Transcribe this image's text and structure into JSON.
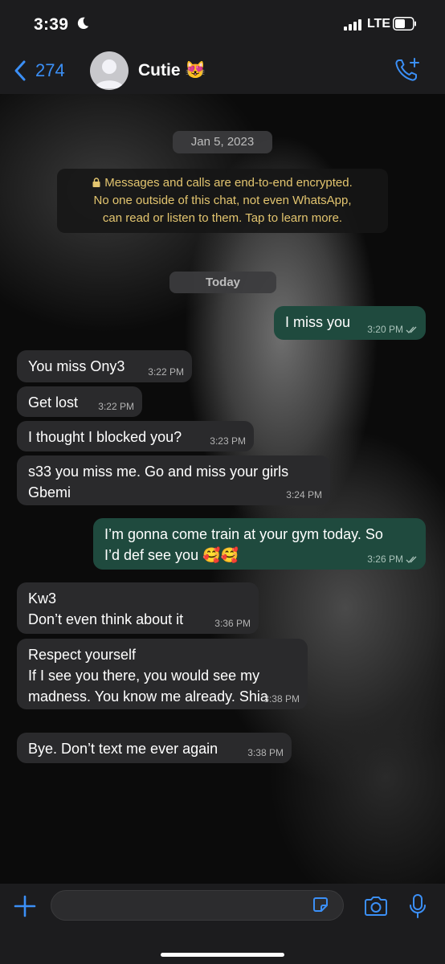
{
  "status_bar": {
    "time": "3:39",
    "network": "LTE"
  },
  "header": {
    "back_count": "274",
    "contact_name": "Cutie 😻"
  },
  "chat": {
    "date_label": "Jan 5, 2023",
    "encryption_notice": {
      "line1": "Messages and calls are end-to-end encrypted.",
      "line2": "No one outside of this chat, not even WhatsApp,",
      "line3": "can read or listen to them. Tap to learn more."
    },
    "today_label": "Today",
    "messages": [
      {
        "dir": "out",
        "lines": [
          "I miss you"
        ],
        "time": "3:20 PM"
      },
      {
        "dir": "in",
        "lines": [
          "You miss Ony3"
        ],
        "time": "3:22 PM"
      },
      {
        "dir": "in",
        "lines": [
          "Get lost"
        ],
        "time": "3:22 PM"
      },
      {
        "dir": "in",
        "lines": [
          "I thought I blocked you?"
        ],
        "time": "3:23 PM"
      },
      {
        "dir": "in",
        "lines": [
          "s33 you miss me. Go and miss your girls",
          "Gbemi"
        ],
        "time": "3:24 PM"
      },
      {
        "dir": "out",
        "lines": [
          "I’m gonna come train at your gym today. So",
          "I’d def see you 🥰🥰"
        ],
        "time": "3:26 PM"
      },
      {
        "dir": "in",
        "lines": [
          "Kw3",
          "Don’t even think about it"
        ],
        "time": "3:36 PM"
      },
      {
        "dir": "in",
        "lines": [
          "Respect yourself",
          "If I see you there, you would see my",
          "madness. You know me already. Shia"
        ],
        "time": "3:38 PM"
      },
      {
        "dir": "in",
        "lines": [
          "Bye. Don’t text me ever again"
        ],
        "time": "3:38 PM"
      }
    ]
  },
  "colors": {
    "accent": "#3b8ff6",
    "outgoing_bubble": "#1f4a3e",
    "incoming_bubble": "#2a2a2c",
    "notice_text": "#e3c56f"
  }
}
